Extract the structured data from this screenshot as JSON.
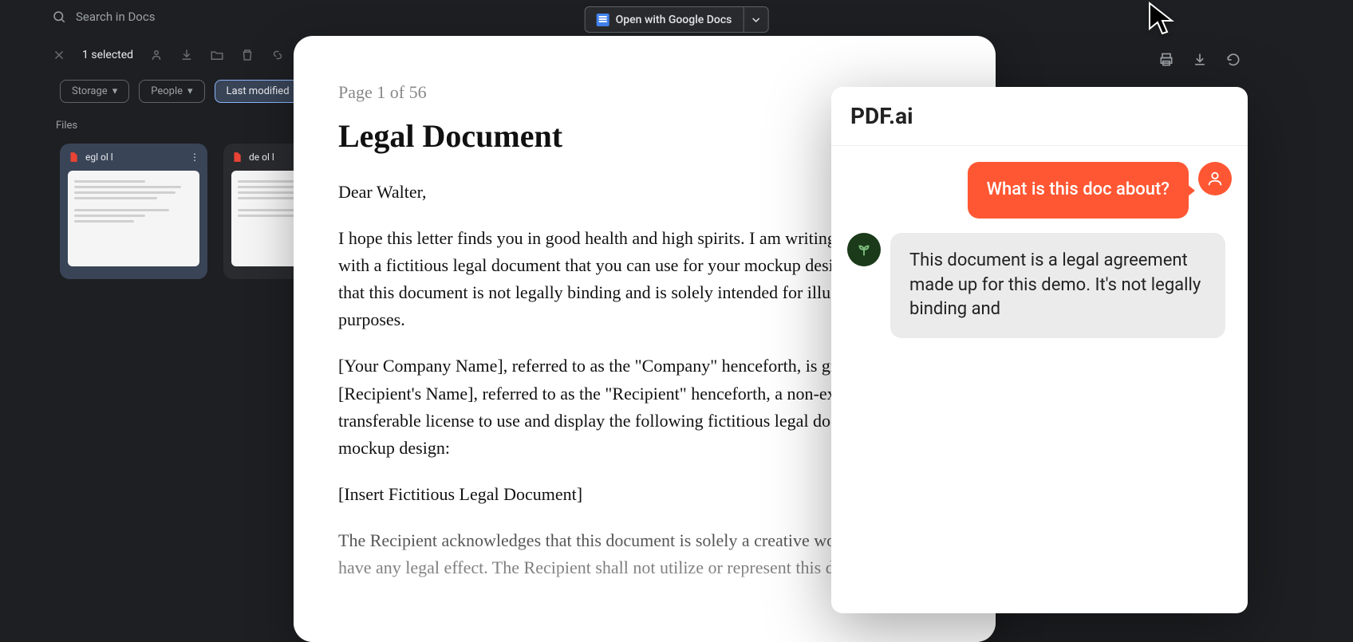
{
  "drive": {
    "search_placeholder": "Search in Docs",
    "open_button": "Open with Google Docs",
    "selected_label": "1 selected",
    "filters": {
      "storage": "Storage",
      "people": "People",
      "last_modified": "Last modified"
    },
    "files_label": "Files",
    "file_names": {
      "file1": "egl ol l",
      "file2": "de ol l"
    }
  },
  "document": {
    "page_label": "Page 1 of 56",
    "title": "Legal Document",
    "greeting": "Dear Walter,",
    "para1": "I hope this letter finds you in good health and high spirits. I am writing to provide you with a fictitious legal document that you can use for your mockup design. Please note that this document is not legally binding and is solely intended for illustrative purposes.",
    "para2": "[Your Company Name], referred to as the \"Company\" henceforth, is granting [Recipient's Name], referred to as the \"Recipient\" henceforth, a non-exclusive, non-transferable license to use and display the following fictitious legal document for their mockup design:",
    "para3": "[Insert Fictitious Legal Document]",
    "para4": "The Recipient acknowledges that this document is solely a creative work and does not have any legal effect. The Recipient shall not utilize or represent this document"
  },
  "chat": {
    "title": "PDF.ai",
    "user_message": "What is this doc about?",
    "ai_message": "This document is a legal agreement made up for this demo. It's not legally binding and"
  }
}
